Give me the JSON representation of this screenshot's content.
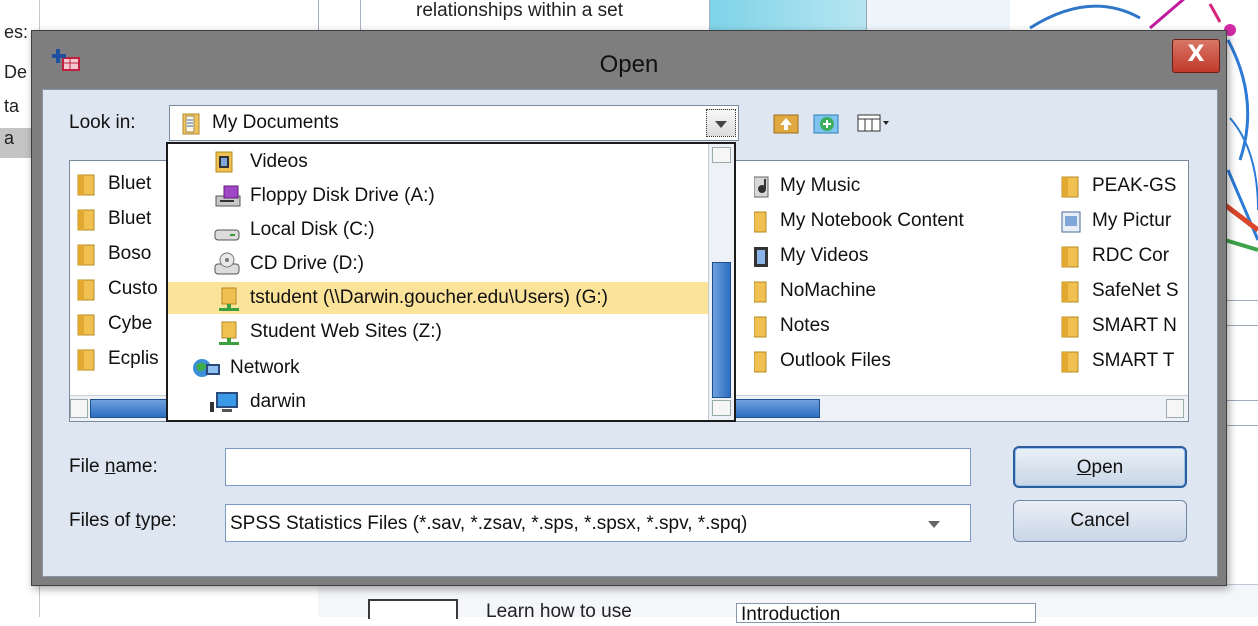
{
  "background": {
    "left_fragments": [
      "es:",
      "De",
      "ta",
      "a"
    ],
    "top_text": "relationships within a set",
    "bottom_text": "Learn how to use",
    "bottom_box": "Introduction"
  },
  "dialog": {
    "title": "Open",
    "close_label": "X",
    "look_in_label": "Look in:",
    "look_in_value": "My Documents",
    "toolbar": {
      "up_icon": "up-folder-icon",
      "new_folder_icon": "new-folder-icon",
      "view_icon": "view-menu-icon"
    },
    "files_col1": [
      "Bluet",
      "Bluet",
      "Boso",
      "Custo",
      "Cybe",
      "Ecplis"
    ],
    "files_col2": [
      "My Music",
      "My Notebook Content",
      "My Videos",
      "NoMachine",
      "Notes",
      "Outlook Files"
    ],
    "files_col3": [
      "PEAK-GS",
      "My Pictur",
      "RDC Cor",
      "SafeNet S",
      "SMART N",
      "SMART T"
    ],
    "dropdown_items": [
      {
        "label": "Videos",
        "icon": "videos-folder-icon"
      },
      {
        "label": "Floppy Disk Drive (A:)",
        "icon": "floppy-drive-icon"
      },
      {
        "label": "Local Disk (C:)",
        "icon": "hard-disk-icon"
      },
      {
        "label": "CD Drive (D:)",
        "icon": "cd-drive-icon"
      },
      {
        "label": "tstudent (\\\\Darwin.goucher.edu\\Users) (G:)",
        "icon": "network-drive-icon"
      },
      {
        "label": "Student Web Sites (Z:)",
        "icon": "network-drive-icon"
      },
      {
        "label": "Network",
        "icon": "network-icon"
      },
      {
        "label": "darwin",
        "icon": "computer-icon"
      }
    ],
    "file_name_label": "File name:",
    "file_name_value": "",
    "files_of_type_label": "Files of type:",
    "files_of_type_value": "SPSS Statistics Files (*.sav, *.zsav, *.sps, *.spsx, *.spv, *.spq)",
    "open_button": "Open",
    "cancel_button": "Cancel"
  }
}
